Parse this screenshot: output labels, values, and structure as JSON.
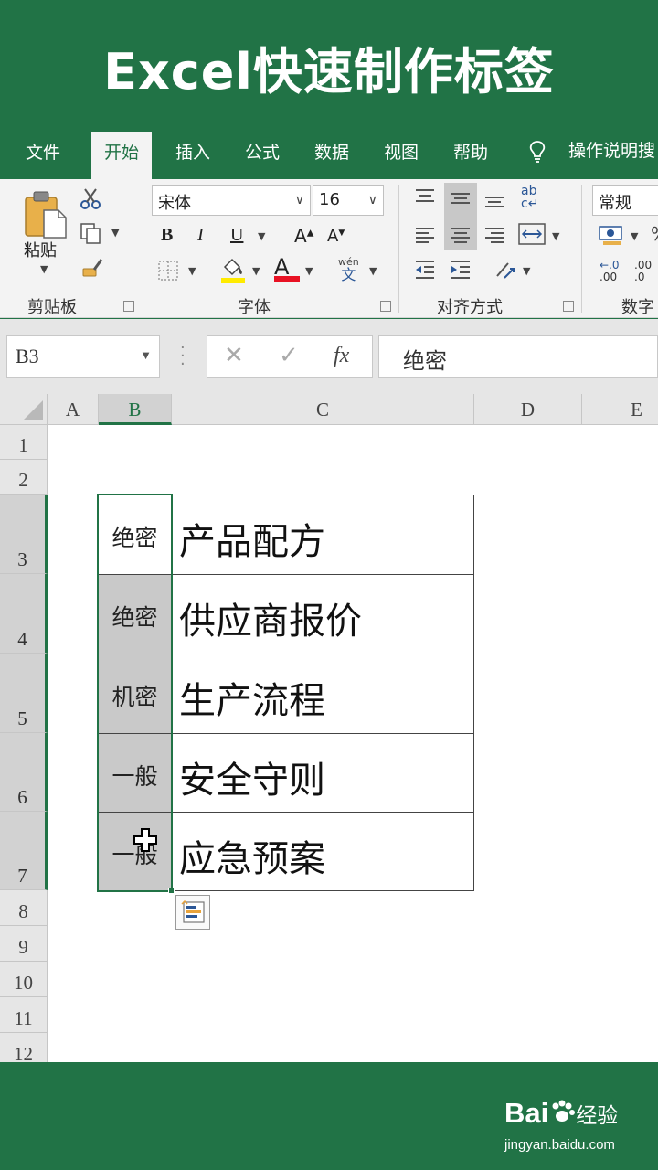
{
  "banner": {
    "title": "Excel快速制作标签"
  },
  "tabs": [
    {
      "label": "文件"
    },
    {
      "label": "开始"
    },
    {
      "label": "插入"
    },
    {
      "label": "公式"
    },
    {
      "label": "数据"
    },
    {
      "label": "视图"
    },
    {
      "label": "帮助"
    }
  ],
  "active_tab": "开始",
  "tell_me": {
    "label": "操作说明搜"
  },
  "ribbon": {
    "clipboard": {
      "paste_label": "粘贴",
      "group_label": "剪贴板"
    },
    "font": {
      "font_name": "宋体",
      "font_size": "16",
      "bold": "B",
      "italic": "I",
      "underline": "U",
      "grow": "A",
      "shrink": "A",
      "font_color": "A",
      "phonetic_top": "wén",
      "phonetic_bottom": "文",
      "group_label": "字体"
    },
    "alignment": {
      "group_label": "对齐方式",
      "wrap_top": "ab",
      "wrap_bottom": "c↵"
    },
    "number": {
      "format": "常规",
      "group_label": "数字",
      "inc": ".00",
      "dec": ".0"
    }
  },
  "formula_bar": {
    "name_box": "B3",
    "formula": "绝密",
    "fx": "fx",
    "cancel": "✕",
    "enter": "✓"
  },
  "columns": [
    "A",
    "B",
    "C",
    "D",
    "E"
  ],
  "rows": [
    "1",
    "2",
    "3",
    "4",
    "5",
    "6",
    "7",
    "8",
    "9",
    "10",
    "11",
    "12"
  ],
  "table": [
    {
      "tag": "绝密",
      "item": "产品配方"
    },
    {
      "tag": "绝密",
      "item": "供应商报价"
    },
    {
      "tag": "机密",
      "item": "生产流程"
    },
    {
      "tag": "一般",
      "item": "安全守则"
    },
    {
      "tag": "一般",
      "item": "应急预案"
    }
  ],
  "watermark": {
    "brand": "Bai",
    "brand2": "经验",
    "url": "jingyan.baidu.com"
  },
  "colors": {
    "excel_green": "#217346",
    "ribbon_bg": "#f3f3f3",
    "selected_fill": "#c9c9c9"
  }
}
